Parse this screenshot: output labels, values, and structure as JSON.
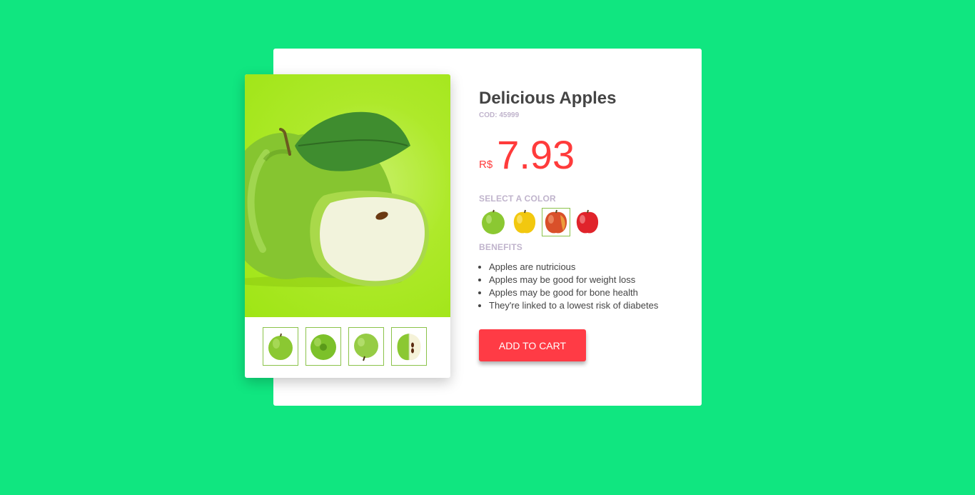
{
  "product": {
    "title": "Delicious Apples",
    "code": "COD: 45999",
    "currency": "R$",
    "price": "7.93",
    "colors_label": "SELECT A COLOR",
    "colors": [
      {
        "name": "green-apple-icon",
        "color": "#8bc832"
      },
      {
        "name": "yellow-apple-icon",
        "color": "#f2c80f"
      },
      {
        "name": "red-yellow-apple-icon",
        "color": "#d9502a",
        "selected": true
      },
      {
        "name": "red-apple-icon",
        "color": "#e0242b"
      }
    ],
    "benefits_label": "BENEFITS",
    "benefits": [
      "Apples are nutricious",
      "Apples may be good for weight loss",
      "Apples may be good for bone health",
      "They're linked to a lowest risk of diabetes"
    ],
    "add_to_cart": "ADD TO CART"
  },
  "theme": {
    "background": "#10e680",
    "accent": "#ff3b45",
    "thumb_border": "#8bc34a"
  }
}
